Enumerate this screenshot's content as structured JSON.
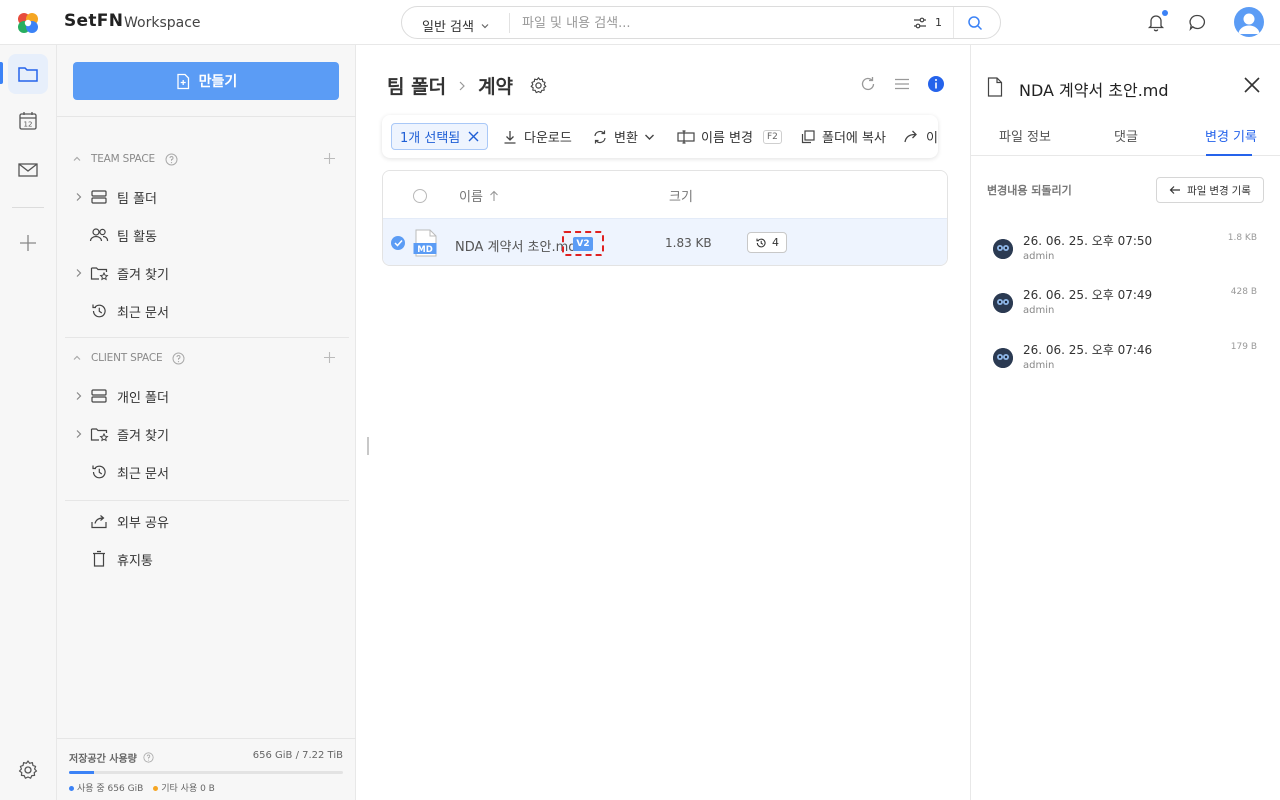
{
  "app": {
    "brand": "SetFN",
    "workspace": "Workspace",
    "brand_colors": [
      "#e74c3c",
      "#f5a623",
      "#27ae60",
      "#3b82f6"
    ],
    "accent": "#3b82f6"
  },
  "search": {
    "type_label": "일반 검색",
    "placeholder": "파일 및 내용 검색...",
    "filter_count": "1"
  },
  "rail": {
    "items": [
      "folder-icon",
      "calendar-icon",
      "mail-icon",
      "plus-icon",
      "settings-icon"
    ],
    "calendar_day": "12"
  },
  "sidebar": {
    "create_label": "만들기",
    "team_space": {
      "title": "TEAM SPACE",
      "items": [
        {
          "label": "팀 폴더",
          "icon": "drive-icon",
          "expandable": true
        },
        {
          "label": "팀 활동",
          "icon": "users-icon",
          "expandable": false
        },
        {
          "label": "즐겨 찾기",
          "icon": "star-folder-icon",
          "expandable": true
        },
        {
          "label": "최근 문서",
          "icon": "history-icon",
          "expandable": false
        }
      ]
    },
    "client_space": {
      "title": "CLIENT SPACE",
      "items": [
        {
          "label": "개인 폴더",
          "icon": "drive-icon",
          "expandable": true
        },
        {
          "label": "즐겨 찾기",
          "icon": "star-folder-icon",
          "expandable": true
        },
        {
          "label": "최근 문서",
          "icon": "history-icon",
          "expandable": false
        }
      ]
    },
    "extra_items": [
      {
        "label": "외부 공유",
        "icon": "share-icon"
      },
      {
        "label": "휴지통",
        "icon": "trash-icon"
      }
    ],
    "storage": {
      "title": "저장공간 사용량",
      "value": "656 GiB / 7.22 TiB",
      "used_fraction": 0.09,
      "used_label": "사용 중 656 GiB",
      "other_label": "기타 사용 0 B",
      "used_color": "#3b82f6",
      "other_color": "#f5a623"
    }
  },
  "main": {
    "breadcrumb": [
      "팀 폴더",
      "계약"
    ],
    "actions": {
      "selected": "1개 선택됨",
      "download": "다운로드",
      "convert": "변환",
      "rename": "이름 변경",
      "rename_key": "F2",
      "copy": "폴더에 복사",
      "move": "이동"
    },
    "table": {
      "columns": [
        "이름",
        "크기"
      ],
      "rows": [
        {
          "name": "NDA 계약서 초안.md",
          "file_type": "MD",
          "version": "V2",
          "size": "1.83 KB",
          "history_count": "4",
          "selected": true
        }
      ]
    }
  },
  "right_panel": {
    "title": "NDA 계약서 초안.md",
    "tabs": [
      "파일 정보",
      "댓글",
      "변경 기록"
    ],
    "active_tab": 2,
    "subtitle": "변경내용 되돌리기",
    "history_button": "파일 변경 기록",
    "history": [
      {
        "date": "26. 06. 25. 오후 07:50",
        "user": "admin",
        "size": "1.8 KB"
      },
      {
        "date": "26. 06. 25. 오후 07:49",
        "user": "admin",
        "size": "428 B"
      },
      {
        "date": "26. 06. 25. 오후 07:46",
        "user": "admin",
        "size": "179 B"
      }
    ]
  }
}
